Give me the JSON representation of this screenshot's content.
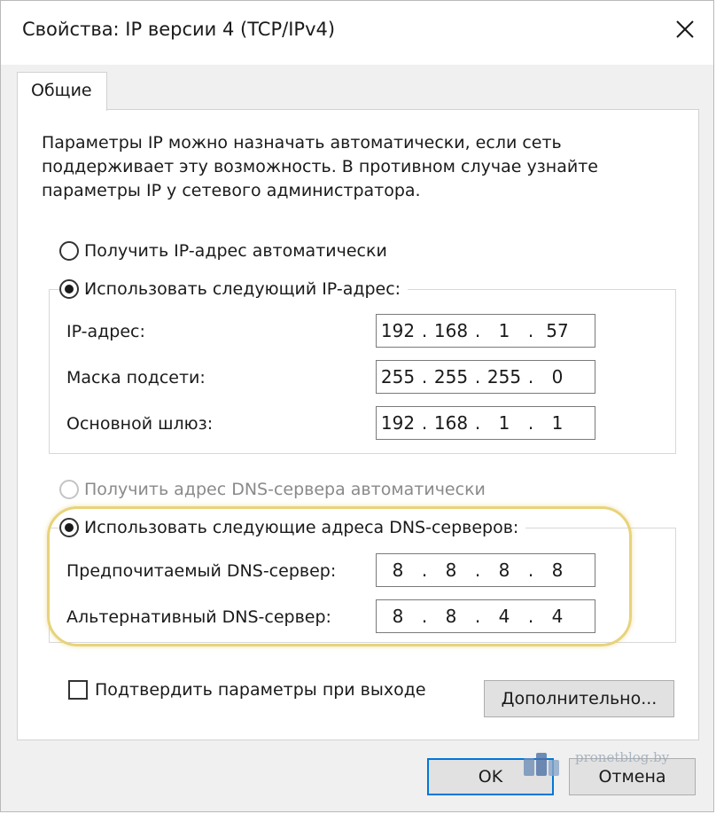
{
  "window": {
    "title": "Свойства: IP версии 4 (TCP/IPv4)"
  },
  "tabs": [
    {
      "label": "Общие",
      "active": true
    }
  ],
  "description": [
    "Параметры IP можно назначать автоматически, если сеть",
    "поддерживает эту возможность. В противном случае узнайте",
    "параметры IP у сетевого администратора."
  ],
  "ip_mode": {
    "auto_label": "Получить IP-адрес автоматически",
    "manual_label": "Использовать следующий IP-адрес:",
    "selected": "manual"
  },
  "ip_fields": [
    {
      "label": "IP-адрес:",
      "octets": [
        "192",
        "168",
        "1",
        "57"
      ]
    },
    {
      "label": "Маска подсети:",
      "octets": [
        "255",
        "255",
        "255",
        "0"
      ]
    },
    {
      "label": "Основной шлюз:",
      "octets": [
        "192",
        "168",
        "1",
        "1"
      ]
    }
  ],
  "dns_mode": {
    "auto_label": "Получить адрес DNS-сервера автоматически",
    "auto_disabled": true,
    "manual_label": "Использовать следующие адреса DNS-серверов:",
    "selected": "manual"
  },
  "dns_fields": [
    {
      "label": "Предпочитаемый DNS-сервер:",
      "octets": [
        "8",
        "8",
        "8",
        "8"
      ]
    },
    {
      "label": "Альтернативный DNS-сервер:",
      "octets": [
        "8",
        "8",
        "4",
        "4"
      ]
    }
  ],
  "validate": {
    "label": "Подтвердить параметры при выходе",
    "checked": false
  },
  "buttons": {
    "advanced": "Дополнительно...",
    "ok": "OK",
    "cancel": "Отмена"
  },
  "watermark": {
    "text": "pronetblog.by"
  },
  "colors": {
    "accent": "#0078d7",
    "highlight": "#e8d37a"
  }
}
